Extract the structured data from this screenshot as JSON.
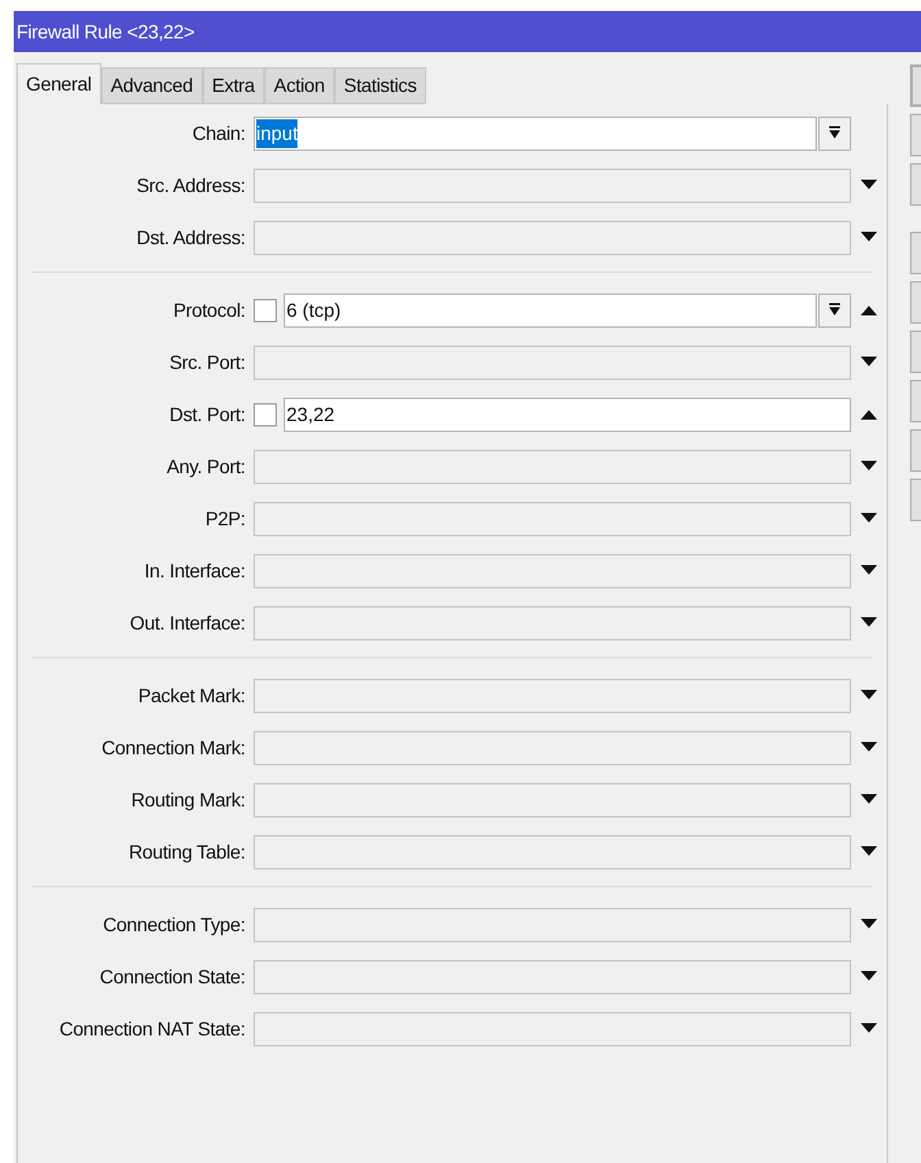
{
  "window": {
    "title": "Firewall Rule <23,22>"
  },
  "tabs": [
    {
      "label": "General",
      "selected": true
    },
    {
      "label": "Advanced",
      "selected": false
    },
    {
      "label": "Extra",
      "selected": false
    },
    {
      "label": "Action",
      "selected": false
    },
    {
      "label": "Statistics",
      "selected": false
    }
  ],
  "sections": [
    {
      "rows": [
        {
          "label": "Chain:",
          "value": "input",
          "value_selected": true,
          "dropdown_button": true
        },
        {
          "label": "Src. Address:",
          "expanded": false
        },
        {
          "label": "Dst. Address:",
          "expanded": false
        }
      ]
    },
    {
      "rows": [
        {
          "label": "Protocol:",
          "value": "6 (tcp)",
          "value_selected": false,
          "checkbox": {
            "checked": false
          },
          "dropdown_button": true,
          "expanded": true
        },
        {
          "label": "Src. Port:",
          "expanded": false
        },
        {
          "label": "Dst. Port:",
          "value": "23,22",
          "value_selected": false,
          "checkbox": {
            "checked": false
          },
          "expanded": true
        },
        {
          "label": "Any. Port:",
          "expanded": false
        },
        {
          "label": "P2P:",
          "expanded": false
        },
        {
          "label": "In. Interface:",
          "expanded": false
        },
        {
          "label": "Out. Interface:",
          "expanded": false
        }
      ]
    },
    {
      "rows": [
        {
          "label": "Packet Mark:",
          "expanded": false
        },
        {
          "label": "Connection Mark:",
          "expanded": false
        },
        {
          "label": "Routing Mark:",
          "expanded": false
        },
        {
          "label": "Routing Table:",
          "expanded": false
        }
      ]
    },
    {
      "rows": [
        {
          "label": "Connection Type:",
          "expanded": false
        },
        {
          "label": "Connection State:",
          "expanded": false
        },
        {
          "label": "Connection NAT State:",
          "expanded": false
        }
      ]
    }
  ]
}
